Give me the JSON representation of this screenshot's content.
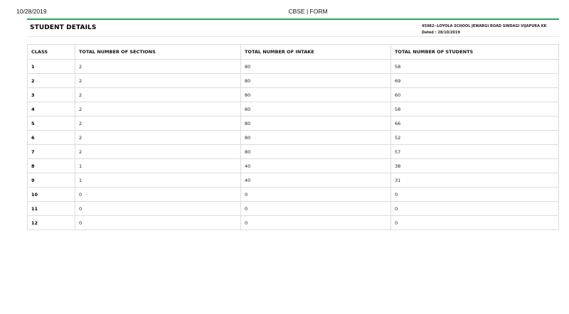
{
  "print_header": {
    "date": "10/28/2019",
    "title": "CBSE | FORM"
  },
  "section": {
    "title": "STUDENT DETAILS",
    "school_line": "45982--LOYOLA SCHOOL JEWARGI ROAD SINDAGI VIJAPURA KK",
    "dated_line": "Dated : 28/10/2019"
  },
  "colors": {
    "accent_rule": "#2aa55a",
    "table_border": "#dcdcdc"
  },
  "table": {
    "headers": [
      "CLASS",
      "TOTAL NUMBER OF SECTIONS",
      "TOTAL NUMBER OF INTAKE",
      "TOTAL NUMBER OF STUDENTS"
    ],
    "rows": [
      [
        "1",
        "2",
        "80",
        "58"
      ],
      [
        "2",
        "2",
        "80",
        "69"
      ],
      [
        "3",
        "2",
        "80",
        "60"
      ],
      [
        "4",
        "2",
        "80",
        "58"
      ],
      [
        "5",
        "2",
        "80",
        "66"
      ],
      [
        "6",
        "2",
        "80",
        "52"
      ],
      [
        "7",
        "2",
        "80",
        "57"
      ],
      [
        "8",
        "1",
        "40",
        "38"
      ],
      [
        "9",
        "1",
        "40",
        "31"
      ],
      [
        "10",
        "0",
        "0",
        "0"
      ],
      [
        "11",
        "0",
        "0",
        "0"
      ],
      [
        "12",
        "0",
        "0",
        "0"
      ]
    ]
  }
}
